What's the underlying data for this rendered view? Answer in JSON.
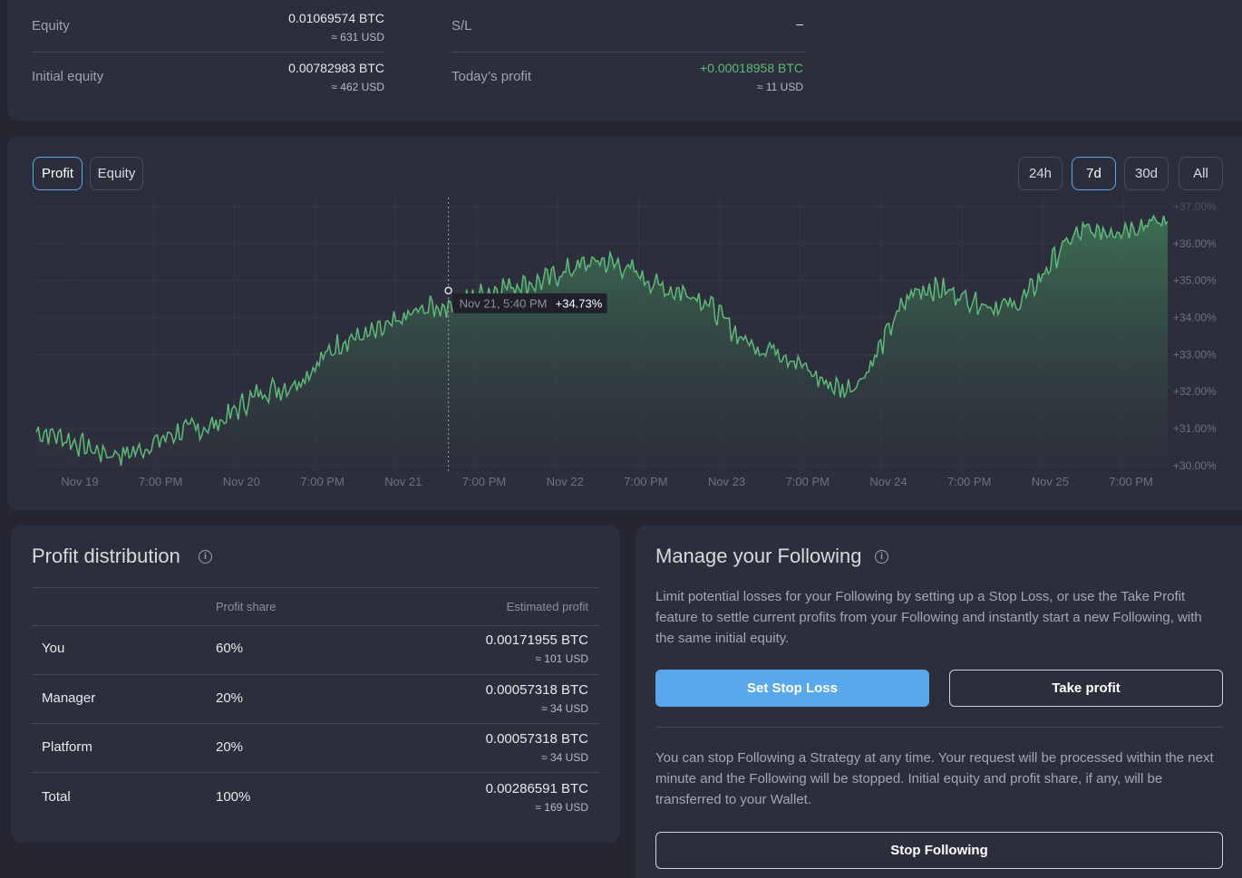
{
  "stats": {
    "equity_label": "Equity",
    "equity_btc": "0.01069574 BTC",
    "equity_usd": "≈ 631 USD",
    "initial_label": "Initial equity",
    "initial_btc": "0.00782983 BTC",
    "initial_usd": "≈ 462 USD",
    "sl_label": "S/L",
    "sl_value": "–",
    "today_label": "Today’s profit",
    "today_btc": "+0.00018958 BTC",
    "today_usd": "≈ 11 USD"
  },
  "chart_tabs": [
    "Profit",
    "Equity"
  ],
  "range_tabs": [
    "24h",
    "7d",
    "30d",
    "All"
  ],
  "tooltip": {
    "date": "Nov 21, 5:40 PM",
    "value": "+34.73%"
  },
  "colors": {
    "accent": "#5aa8ec",
    "positive": "#5fb97a",
    "line": "#5fb97a"
  },
  "chart_data": {
    "type": "area",
    "x_ticks": [
      "Nov 19",
      "7:00 PM",
      "Nov 20",
      "7:00 PM",
      "Nov 21",
      "7:00 PM",
      "Nov 22",
      "7:00 PM",
      "Nov 23",
      "7:00 PM",
      "Nov 24",
      "7:00 PM",
      "Nov 25",
      "7:00 PM"
    ],
    "y_ticks": [
      "+37.00%",
      "+36.00%",
      "+35.00%",
      "+34.00%",
      "+33.00%",
      "+32.00%",
      "+31.00%",
      "+30.00%"
    ],
    "ylim": [
      29.8,
      37.0
    ],
    "x": [
      0,
      0.5,
      1,
      1.5,
      2,
      2.5,
      3,
      3.5,
      4,
      4.5,
      5,
      5.5,
      6,
      6.5,
      7
    ],
    "values": [
      30.9,
      30.3,
      31.0,
      32.1,
      33.5,
      34.3,
      34.9,
      35.5,
      34.7,
      33.2,
      32.1,
      34.8,
      34.3,
      36.3,
      36.6
    ],
    "grid": true,
    "series": [
      {
        "values": [
          30.9,
          30.3,
          31.0,
          32.1,
          33.5,
          34.3,
          34.9,
          35.5,
          34.7,
          33.2,
          32.1,
          34.8,
          34.3,
          36.3,
          36.6
        ]
      }
    ]
  },
  "distribution": {
    "title": "Profit distribution",
    "col_share": "Profit share",
    "col_estimated": "Estimated profit",
    "rows": [
      {
        "name": "You",
        "share": "60%",
        "btc": "0.00171955 BTC",
        "usd": "≈ 101 USD"
      },
      {
        "name": "Manager",
        "share": "20%",
        "btc": "0.00057318 BTC",
        "usd": "≈ 34 USD"
      },
      {
        "name": "Platform",
        "share": "20%",
        "btc": "0.00057318 BTC",
        "usd": "≈ 34 USD"
      },
      {
        "name": "Total",
        "share": "100%",
        "btc": "0.00286591 BTC",
        "usd": "≈ 169 USD"
      }
    ]
  },
  "manage": {
    "title": "Manage your Following",
    "desc1": "Limit potential losses for your Following by setting up a Stop Loss, or use the Take Profit feature to settle current profits from your Following and instantly start a new Following, with the same initial equity.",
    "set_sl": "Set Stop Loss",
    "take_profit": "Take profit",
    "desc2": "You can stop Following a Strategy at any time. Your request will be processed within the next minute and the Following will be stopped. Initial equity and profit share, if any, will be transferred to your Wallet.",
    "stop": "Stop Following"
  }
}
